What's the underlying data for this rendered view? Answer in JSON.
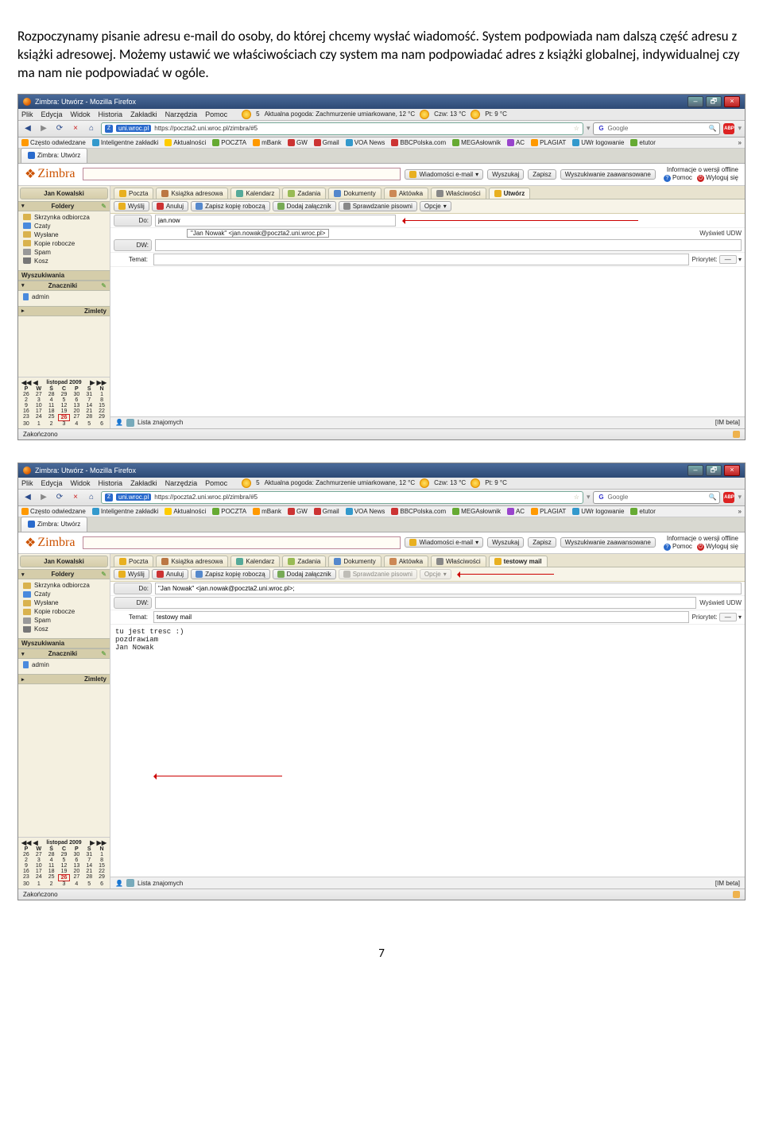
{
  "intro": "Rozpoczynamy pisanie adresu e-mail do osoby, do której chcemy wysłać wiadomość. System podpowiada nam dalszą część adresu z książki adresowej. Możemy ustawić we właściwościach czy system ma nam podpowiadać adres z książki globalnej, indywidualnej czy ma nam nie podpowiadać w ogóle.",
  "window": {
    "title": "Zimbra: Utwórz - Mozilla Firefox",
    "minimize": "–",
    "restore": "🗗",
    "close": "×"
  },
  "menu": {
    "items": [
      "Plik",
      "Edycja",
      "Widok",
      "Historia",
      "Zakładki",
      "Narzędzia",
      "Pomoc"
    ]
  },
  "weather": {
    "sun_lbl": "5",
    "text1": "Aktualna pogoda: Zachmurzenie umiarkowane, 12 °C",
    "text2": "Czw: 13 °C",
    "text3": "Pt: 9 °C"
  },
  "nav": {
    "reload": "⟳",
    "stop": "×",
    "home": "⌂"
  },
  "url": {
    "favtext": "Z",
    "domain": "uni.wroc.pl",
    "full": "https://poczta2.uni.wroc.pl/zimbra/#5",
    "star": "☆"
  },
  "search": {
    "g": "G",
    "placeholder": "Google"
  },
  "abp": "ABP",
  "bookmarks": {
    "items": [
      "Często odwiedzane",
      "Inteligentne zakładki",
      "Aktualności",
      "POCZTA",
      "mBank",
      "GW",
      "Gmail",
      "VOA News",
      "BBCPolska.com",
      "MEGAsłownik",
      "AC",
      "PLAGIAT",
      "UWr logowanie",
      "etutor"
    ],
    "more": "»"
  },
  "tab": "Zimbra: Utwórz",
  "zimbra": {
    "logo": "Zimbra",
    "search_type": "Wiadomości e-mail",
    "search_btn": "Wyszukaj",
    "save": "Zapisz",
    "adv": "Wyszukiwanie zaawansowane",
    "offline": "Informacje o wersji offline",
    "help": "Pomoc",
    "logout": "Wyloguj się"
  },
  "user": "Jan Kowalski",
  "sidebar": {
    "folders_hdr": "Foldery",
    "folders": [
      "Skrzynka odbiorcza",
      "Czaty",
      "Wysłane",
      "Kopie robocze",
      "Spam",
      "Kosz"
    ],
    "searches_hdr": "Wyszukiwania",
    "tags_hdr": "Znaczniki",
    "tags": [
      "admin"
    ],
    "zimlets_hdr": "Zimlety"
  },
  "calendar": {
    "title": "listopad 2009",
    "dow": [
      "P",
      "W",
      "Ś",
      "C",
      "P",
      "S",
      "N"
    ],
    "rows": [
      [
        "26",
        "27",
        "28",
        "29",
        "30",
        "31",
        "1"
      ],
      [
        "2",
        "3",
        "4",
        "5",
        "6",
        "7",
        "8"
      ],
      [
        "9",
        "10",
        "11",
        "12",
        "13",
        "14",
        "15"
      ],
      [
        "16",
        "17",
        "18",
        "19",
        "20",
        "21",
        "22"
      ],
      [
        "23",
        "24",
        "25",
        "26",
        "27",
        "28",
        "29"
      ],
      [
        "30",
        "1",
        "2",
        "3",
        "4",
        "5",
        "6"
      ]
    ],
    "today": "26"
  },
  "app_tabs": {
    "common": [
      "Poczta",
      "Książka adresowa",
      "Kalendarz",
      "Zadania",
      "Dokumenty",
      "Aktówka",
      "Właściwości"
    ],
    "compose1": "Utwórz",
    "compose2": "testowy mail"
  },
  "toolbar": {
    "send": "Wyślij",
    "cancel": "Anuluj",
    "savedraft": "Zapisz kopię roboczą",
    "attach": "Dodaj załącznik",
    "spell": "Sprawdzanie pisowni",
    "options": "Opcje"
  },
  "compose": {
    "to": "Do:",
    "cc": "DW:",
    "subject": "Temat:",
    "show_bcc": "Wyświetl UDW",
    "priority": "Priorytet:",
    "prio_val": "—"
  },
  "shot1": {
    "to_val": "jan.now",
    "suggestion": "\"Jan Nowak\" <jan.nowak@poczta2.uni.wroc.pl>",
    "subject_val": ""
  },
  "shot2": {
    "to_val": "\"Jan Nowak\" <jan.nowak@poczta2.uni.wroc.pl>;",
    "subject_val": "testowy mail",
    "body_line1": "tu jest tresc :)",
    "body_line2": "pozdrawiam",
    "body_line3": "Jan Nowak"
  },
  "friends": "Lista znajomych",
  "im_beta": "[IM beta]",
  "status": "Zakończono",
  "page_number": "7"
}
